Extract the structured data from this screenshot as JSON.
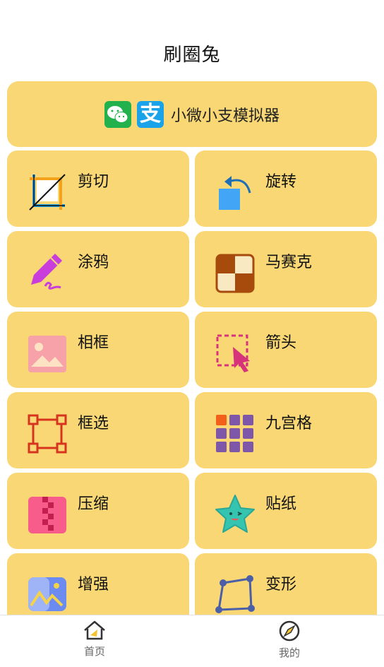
{
  "header": {
    "title": "刷圈兔"
  },
  "banner": {
    "label": "小微小支模拟器",
    "icons": [
      "wechat-icon",
      "alipay-icon"
    ],
    "alipay_glyph": "支"
  },
  "tools": [
    {
      "label": "剪切",
      "icon": "crop-icon"
    },
    {
      "label": "旋转",
      "icon": "rotate-icon"
    },
    {
      "label": "涂鸦",
      "icon": "doodle-pen-icon"
    },
    {
      "label": "马赛克",
      "icon": "mosaic-icon"
    },
    {
      "label": "相框",
      "icon": "photo-frame-icon"
    },
    {
      "label": "箭头",
      "icon": "arrow-cursor-icon"
    },
    {
      "label": "框选",
      "icon": "box-select-icon"
    },
    {
      "label": "九宫格",
      "icon": "nine-grid-icon"
    },
    {
      "label": "压缩",
      "icon": "compress-icon"
    },
    {
      "label": "贴纸",
      "icon": "sticker-star-icon"
    },
    {
      "label": "增强",
      "icon": "enhance-image-icon"
    },
    {
      "label": "变形",
      "icon": "transform-icon"
    }
  ],
  "tabbar": {
    "items": [
      {
        "label": "首页",
        "icon": "home-icon"
      },
      {
        "label": "我的",
        "icon": "compass-icon"
      }
    ]
  },
  "colors": {
    "card_bg": "#f8d774",
    "wechat_green": "#22b14c",
    "alipay_blue": "#1aa3e8"
  }
}
